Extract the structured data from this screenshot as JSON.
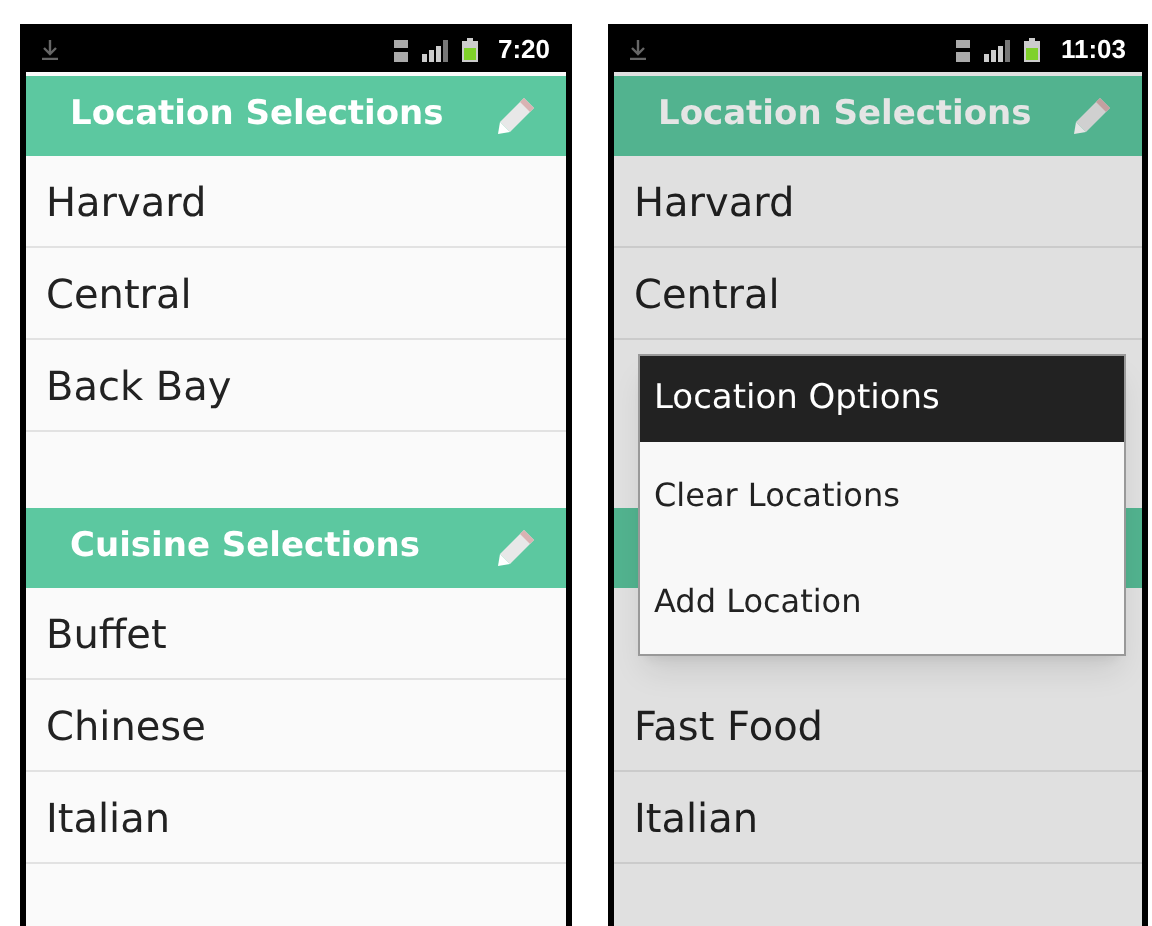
{
  "screens": [
    {
      "status_bar": {
        "time": "7:20"
      },
      "sections": [
        {
          "title": "Location Selections",
          "items": [
            "Harvard",
            "Central",
            "Back Bay"
          ]
        },
        {
          "title": "Cuisine Selections",
          "items": [
            "Buffet",
            "Chinese",
            "Italian"
          ]
        }
      ]
    },
    {
      "status_bar": {
        "time": "11:03"
      },
      "sections": [
        {
          "title": "Location Selections",
          "items": [
            "Harvard",
            "Central"
          ]
        },
        {
          "items": [
            "Fast Food",
            "Italian"
          ]
        }
      ],
      "dialog": {
        "title": "Location Options",
        "options": [
          "Clear Locations",
          "Add Location"
        ]
      }
    }
  ]
}
